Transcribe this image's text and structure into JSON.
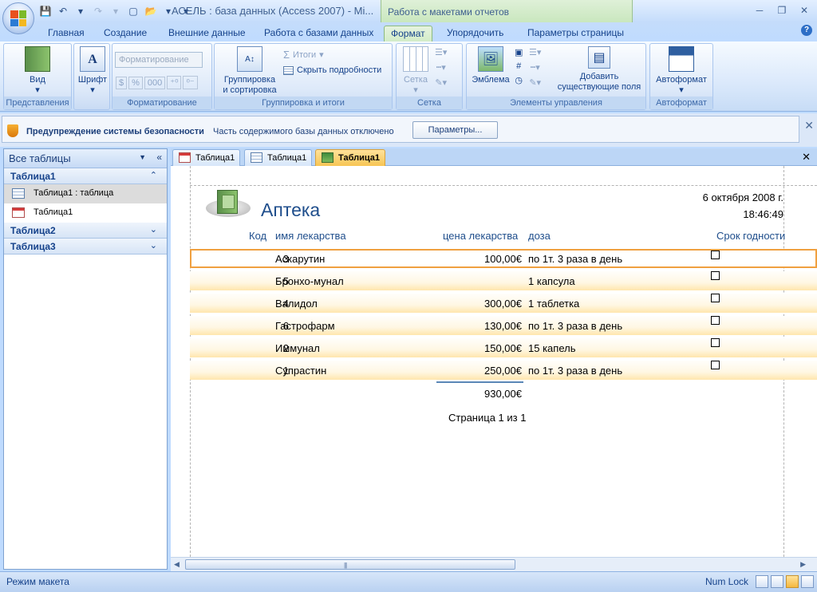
{
  "window": {
    "title": "АСЕЛЬ : база данных (Access 2007) - Mi...",
    "context_title": "Работа с макетами отчетов"
  },
  "ribbon_tabs": [
    "Главная",
    "Создание",
    "Внешние данные",
    "Работа с базами данных",
    "Формат",
    "Упорядочить",
    "Параметры страницы"
  ],
  "ribbon": {
    "view_label": "Вид",
    "font_label": "Шрифт",
    "formatting_combo": "Форматирование",
    "grouping_label_1": "Группировка",
    "grouping_label_2": "и сортировка",
    "totals_label": "Итоги",
    "hide_details_label": "Скрыть подробности",
    "grid_label": "Сетка",
    "logo_label": "Эмблема",
    "add_fields_label_1": "Добавить",
    "add_fields_label_2": "существующие поля",
    "autoformat_label": "Автоформат",
    "groups": {
      "views": "Представления",
      "formatting": "Форматирование",
      "grouping": "Группировка и итоги",
      "gridlines": "Сетка",
      "controls": "Элементы управления",
      "autoformat": "Автоформат"
    }
  },
  "security": {
    "title": "Предупреждение системы безопасности",
    "message": "Часть содержимого базы данных отключено",
    "button": "Параметры..."
  },
  "nav": {
    "header": "Все таблицы",
    "groups": [
      {
        "name": "Таблица1",
        "items": [
          "Таблица1 : таблица",
          "Таблица1"
        ]
      },
      {
        "name": "Таблица2"
      },
      {
        "name": "Таблица3"
      }
    ]
  },
  "doc_tabs": [
    "Таблица1",
    "Таблица1",
    "Таблица1"
  ],
  "report": {
    "title": "Аптека",
    "date": "6 октября 2008 г.",
    "time": "18:46:49",
    "columns": [
      "Код",
      "имя лекарства",
      "цена лекарства",
      "доза",
      "Срок годности"
    ],
    "rows": [
      {
        "code": "3",
        "name": "Аскарутин",
        "price": "100,00€",
        "dose": "по 1т. 3 раза в день"
      },
      {
        "code": "5",
        "name": "Бронхо-мунал",
        "price": "",
        "dose": "1 капсула"
      },
      {
        "code": "4",
        "name": "Валидол",
        "price": "300,00€",
        "dose": "1 таблетка"
      },
      {
        "code": "6",
        "name": "Гастрофарм",
        "price": "130,00€",
        "dose": "по 1т. 3 раза в день"
      },
      {
        "code": "2",
        "name": "Иммунал",
        "price": "150,00€",
        "dose": "15 капель"
      },
      {
        "code": "1",
        "name": "Супрастин",
        "price": "250,00€",
        "dose": "по 1т. 3 раза в день"
      }
    ],
    "total": "930,00€",
    "pager": "Страница 1 из 1"
  },
  "status": {
    "left": "Режим макета",
    "numlock": "Num Lock"
  }
}
